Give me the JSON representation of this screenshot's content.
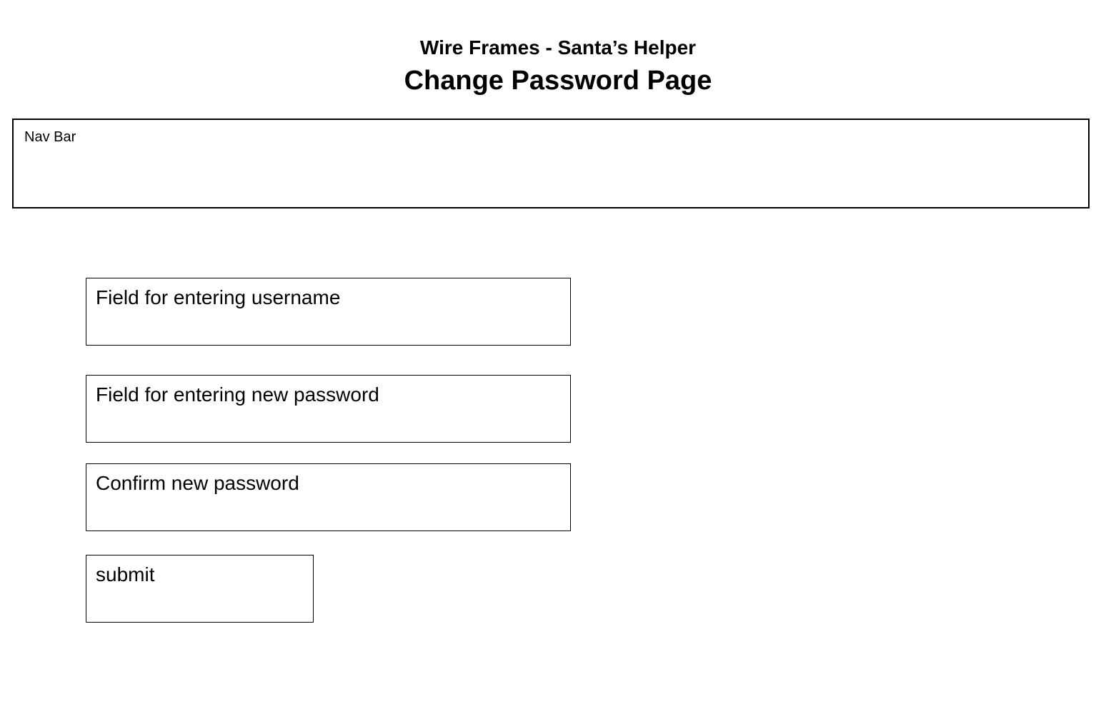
{
  "header": {
    "title": "Wire Frames - Santa’s Helper",
    "subtitle": "Change Password Page"
  },
  "nav_bar": {
    "label": "Nav Bar"
  },
  "form": {
    "username_label": "Field for entering username",
    "new_password_label": "Field for entering new password",
    "confirm_password_label": "Confirm new password",
    "submit_label": "submit"
  }
}
